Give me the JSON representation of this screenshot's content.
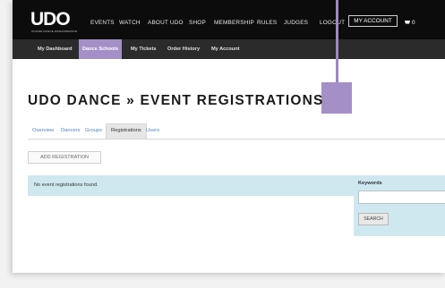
{
  "topnav": {
    "logo": "UDO",
    "logo_tagline": "UNITED DANCE ORGANISATION",
    "items": [
      "EVENTS",
      "WATCH",
      "ABOUT UDO",
      "SHOP",
      "MEMBERSHIP",
      "RULES",
      "JUDGES"
    ],
    "logout": "LOGOUT",
    "my_account": "MY ACCOUNT",
    "cart_count": "0"
  },
  "subnav": {
    "items": [
      "My Dashboard",
      "Dance Schools",
      "My Tickets",
      "Order History",
      "My Account"
    ],
    "active": "Dance Schools"
  },
  "page": {
    "title": "UDO DANCE » EVENT REGISTRATIONS",
    "tabs": [
      "Overview",
      "Dancers",
      "Groups",
      "Registrations",
      "Users"
    ],
    "active_tab": "Registrations",
    "add_button": "ADD REGISTRATION",
    "notice": "No event registrations found."
  },
  "sidebar": {
    "keywords_label": "Keywords",
    "keywords_value": "",
    "search_button": "SEARCH"
  },
  "colors": {
    "accent": "#a58fc7",
    "topnav_bg": "#0c0c0c",
    "subnav_bg": "#2b2b2b",
    "notice_bg": "#cfe8f0",
    "link": "#4f86bd"
  }
}
